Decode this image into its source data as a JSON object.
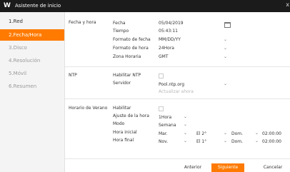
{
  "window": {
    "logo": "W",
    "title": "Asistente de inicio",
    "close": "x"
  },
  "sidebar": {
    "items": [
      {
        "label": "1.Red"
      },
      {
        "label": "2.Fecha/Hora"
      },
      {
        "label": "3.Disco"
      },
      {
        "label": "4.Resolución"
      },
      {
        "label": "5.Móvil"
      },
      {
        "label": "6.Resumen"
      }
    ]
  },
  "fecha_hora": {
    "section": "Fecha y hora",
    "fecha_label": "Fecha",
    "fecha_value": "05/04/2019",
    "tiempo_label": "Tiempo",
    "tiempo_value": "05:43:11",
    "formato_fecha_label": "Formato de fecha",
    "formato_fecha_value": "MM/DD/YY",
    "formato_hora_label": "Formato de hora",
    "formato_hora_value": "24Hora",
    "zona_label": "Zona Horaria",
    "zona_value": "GMT"
  },
  "ntp": {
    "section": "NTP",
    "habilitar_label": "Habilitar NTP",
    "servidor_label": "Servidor",
    "servidor_value": "Pool.ntp.org",
    "actualizar": "Actualizar ahora"
  },
  "verano": {
    "section": "Horario de Verano",
    "habilitar_label": "Habilitar",
    "ajuste_label": "Ajuste de la hora",
    "ajuste_value": "1Hora",
    "modo_label": "Modo",
    "modo_value": "Semana",
    "inicial_label": "Hora inicial",
    "inicial": {
      "mes": "Mar.",
      "semana": "El 2°",
      "dia": "Dom.",
      "hora": "02:00:00"
    },
    "final_label": "Hora final",
    "final": {
      "mes": "Nov.",
      "semana": "El 1°",
      "dia": "Dom.",
      "hora": "02:00:00"
    }
  },
  "footer": {
    "back": "Anterior",
    "next": "Siguiente",
    "cancel": "Cancelar"
  },
  "colors": {
    "accent": "#ff7a00",
    "titlebar": "#1b1b1b"
  }
}
